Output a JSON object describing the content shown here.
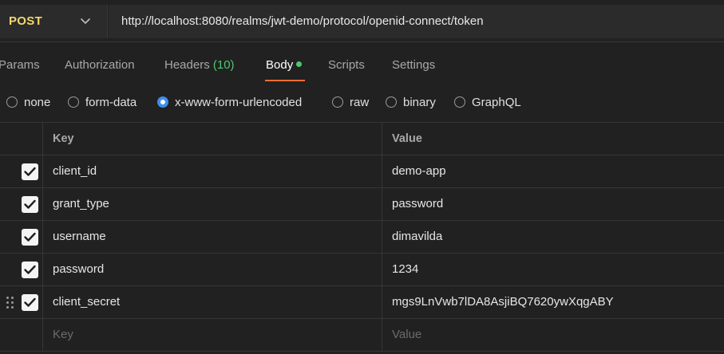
{
  "request": {
    "method": "POST",
    "url": "http://localhost:8080/realms/jwt-demo/protocol/openid-connect/token"
  },
  "tabs": [
    {
      "label": "Params"
    },
    {
      "label": "Authorization"
    },
    {
      "label": "Headers",
      "count": "(10)"
    },
    {
      "label": "Body",
      "active": true
    },
    {
      "label": "Scripts"
    },
    {
      "label": "Settings"
    }
  ],
  "body_types": [
    {
      "label": "none",
      "selected": false
    },
    {
      "label": "form-data",
      "selected": false
    },
    {
      "label": "x-www-form-urlencoded",
      "selected": true
    },
    {
      "label": "raw",
      "selected": false
    },
    {
      "label": "binary",
      "selected": false
    },
    {
      "label": "GraphQL",
      "selected": false
    }
  ],
  "table": {
    "headers": {
      "key": "Key",
      "value": "Value"
    },
    "rows": [
      {
        "key": "client_id",
        "value": "demo-app",
        "checked": true
      },
      {
        "key": "grant_type",
        "value": "password",
        "checked": true
      },
      {
        "key": "username",
        "value": "dimavilda",
        "checked": true
      },
      {
        "key": "password",
        "value": "1234",
        "checked": true
      },
      {
        "key": "client_secret",
        "value": "mgs9LnVwb7lDA8AsjiBQ7620ywXqgABY",
        "checked": true
      }
    ],
    "new_row": {
      "key_placeholder": "Key",
      "value_placeholder": "Value"
    }
  },
  "colors": {
    "method": "#f5d76e",
    "active_indicator": "#4ec770",
    "tab_underline": "#ff6c37",
    "radio_selected": "#3f8ef0"
  },
  "icons": {
    "method_dropdown": "chevron-down-icon",
    "checkbox": "checkmark-icon",
    "drag": "drag-handle-icon"
  }
}
